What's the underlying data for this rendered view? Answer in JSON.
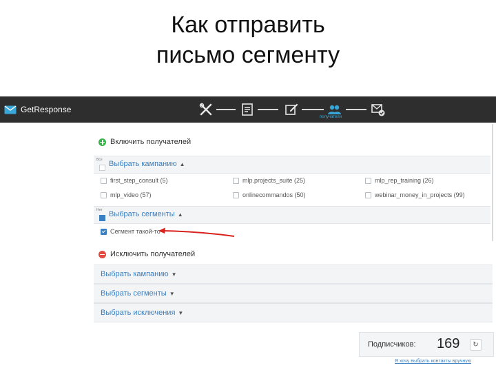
{
  "slide": {
    "title_line1": "Как отправить",
    "title_line2": "письмо сегменту"
  },
  "app": {
    "brand": "GetResponse",
    "step_caption": "получатели",
    "steps": [
      "tools-icon",
      "template-icon",
      "edit-icon",
      "recipients-icon",
      "send-check-icon"
    ]
  },
  "include": {
    "title": "Включить получателей",
    "campaigns": {
      "mini_label": "Все",
      "label": "Выбрать кампанию",
      "items": [
        {
          "label": "first_step_consult (5)",
          "checked": false
        },
        {
          "label": "mlp.projects_suite (25)",
          "checked": false
        },
        {
          "label": "mlp_rep_training (26)",
          "checked": false
        },
        {
          "label": "mlp_video (57)",
          "checked": false
        },
        {
          "label": "onlinecommandos (50)",
          "checked": false
        },
        {
          "label": "webinar_money_in_projects (99)",
          "checked": false
        }
      ]
    },
    "segments": {
      "mini_label": "Нет",
      "label": "Выбрать сегменты",
      "items": [
        {
          "label": "Сегмент такой-то",
          "checked": true
        }
      ]
    }
  },
  "exclude": {
    "title": "Исключить получателей",
    "rows": [
      {
        "label": "Выбрать кампанию"
      },
      {
        "label": "Выбрать сегменты"
      },
      {
        "label": "Выбрать исключения"
      }
    ]
  },
  "subscribers": {
    "label": "Подписчиков:",
    "count": "169",
    "refresh_icon": "↻"
  },
  "footer_link": "Я хочу выбрать контакты вручную",
  "colors": {
    "appbar": "#2e2e2e",
    "link_blue": "#3a7fc1",
    "include_green": "#37b34a",
    "exclude_red": "#e04a3f",
    "arrow_red": "#d9221c"
  }
}
